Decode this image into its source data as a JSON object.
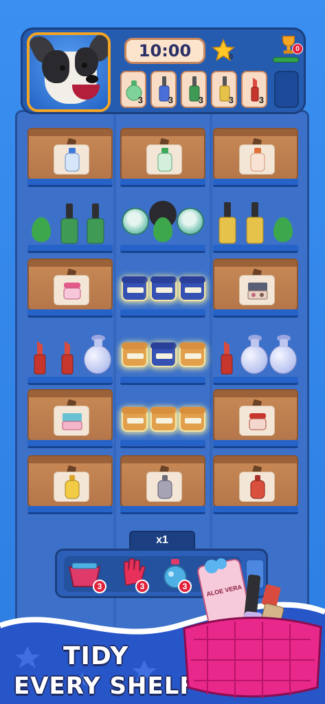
{
  "hud": {
    "timer": "10:00",
    "stars": "0",
    "trophy_count": "0",
    "goals": [
      {
        "item": "green-perfume",
        "count": "3",
        "color": "#5fbf7a"
      },
      {
        "item": "blue-nail-polish",
        "count": "3",
        "color": "#4a6fd8"
      },
      {
        "item": "green-nail-polish",
        "count": "3",
        "color": "#3f9a55"
      },
      {
        "item": "yellow-nail-polish",
        "count": "3",
        "color": "#e6c24a"
      },
      {
        "item": "red-lipstick",
        "count": "3",
        "color": "#d94b3e"
      }
    ]
  },
  "booster": {
    "multiplier": "x1",
    "items": [
      {
        "name": "shopping-basket",
        "count": "3"
      },
      {
        "name": "glove",
        "count": "3"
      },
      {
        "name": "magic-bottle",
        "count": "3"
      }
    ]
  },
  "promo": {
    "line1": "TIDY",
    "line2": "EVERY SHELF",
    "product_label": "ALOE VERA"
  },
  "colors": {
    "accent": "#f5a524",
    "background": "#2d7de0",
    "badge": "#e2213b"
  }
}
